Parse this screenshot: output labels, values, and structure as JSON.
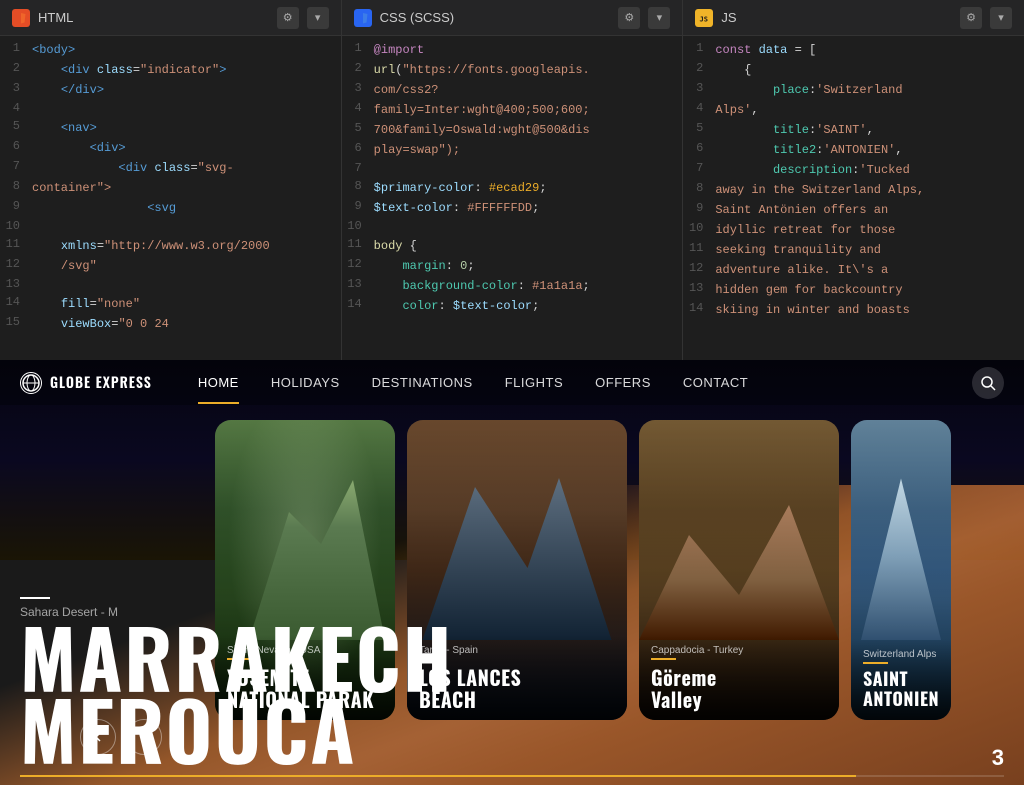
{
  "editor": {
    "panels": [
      {
        "id": "html",
        "tab_icon": "HTML",
        "tab_label": "HTML",
        "tab_color": "html",
        "lines": [
          {
            "num": 1,
            "tokens": [
              {
                "t": "<",
                "c": "c-tag"
              },
              {
                "t": "body",
                "c": "c-tag"
              },
              {
                "t": ">",
                "c": "c-tag"
              }
            ]
          },
          {
            "num": 2,
            "tokens": [
              {
                "t": "    ",
                "c": ""
              },
              {
                "t": "<",
                "c": "c-tag"
              },
              {
                "t": "div",
                "c": "c-tag"
              },
              {
                "t": " ",
                "c": ""
              },
              {
                "t": "class",
                "c": "c-attr"
              },
              {
                "t": "=\"",
                "c": "c-str"
              },
              {
                "t": "indicator",
                "c": "c-str"
              },
              {
                "t": "\">",
                "c": "c-str"
              }
            ]
          },
          {
            "num": 3,
            "tokens": [
              {
                "t": "    ",
                "c": ""
              },
              {
                "t": "</",
                "c": "c-tag"
              },
              {
                "t": "div",
                "c": "c-tag"
              },
              {
                "t": ">",
                "c": "c-tag"
              }
            ]
          },
          {
            "num": 4,
            "tokens": []
          },
          {
            "num": 5,
            "tokens": [
              {
                "t": "    ",
                "c": ""
              },
              {
                "t": "<",
                "c": "c-tag"
              },
              {
                "t": "nav",
                "c": "c-tag"
              },
              {
                "t": ">",
                "c": "c-tag"
              }
            ]
          },
          {
            "num": 6,
            "tokens": [
              {
                "t": "        ",
                "c": ""
              },
              {
                "t": "<",
                "c": "c-tag"
              },
              {
                "t": "div",
                "c": "c-tag"
              },
              {
                "t": ">",
                "c": "c-tag"
              }
            ]
          },
          {
            "num": 7,
            "tokens": [
              {
                "t": "            ",
                "c": ""
              },
              {
                "t": "<",
                "c": "c-tag"
              },
              {
                "t": "div",
                "c": "c-tag"
              },
              {
                "t": " ",
                "c": ""
              },
              {
                "t": "class",
                "c": "c-attr"
              },
              {
                "t": "=\"",
                "c": "c-str"
              },
              {
                "t": "svg-",
                "c": "c-str"
              }
            ]
          },
          {
            "num": 8,
            "tokens": [
              {
                "t": "container\">",
                "c": "c-str"
              }
            ]
          },
          {
            "num": 9,
            "tokens": [
              {
                "t": "                ",
                "c": ""
              },
              {
                "t": "<",
                "c": "c-tag"
              },
              {
                "t": "svg",
                "c": "c-tag"
              }
            ]
          },
          {
            "num": 10,
            "tokens": []
          },
          {
            "num": 11,
            "tokens": [
              {
                "t": "    ",
                "c": ""
              },
              {
                "t": "xmlns",
                "c": "c-attr"
              },
              {
                "t": "=\"",
                "c": "c-str"
              },
              {
                "t": "http://www.w3.org/2000",
                "c": "c-str"
              }
            ]
          },
          {
            "num": 12,
            "tokens": [
              {
                "t": "    ",
                "c": ""
              },
              {
                "t": "/svg\"",
                "c": "c-str"
              }
            ]
          },
          {
            "num": 13,
            "tokens": []
          },
          {
            "num": 14,
            "tokens": [
              {
                "t": "    ",
                "c": ""
              },
              {
                "t": "fill",
                "c": "c-attr"
              },
              {
                "t": "=\"",
                "c": "c-str"
              },
              {
                "t": "none\"",
                "c": "c-str"
              }
            ]
          },
          {
            "num": 15,
            "tokens": [
              {
                "t": "    ",
                "c": ""
              },
              {
                "t": "viewBox",
                "c": "c-attr"
              },
              {
                "t": "=\"0 0 24",
                "c": "c-str"
              }
            ]
          }
        ]
      },
      {
        "id": "css",
        "tab_icon": "CSS",
        "tab_label": "CSS (SCSS)",
        "tab_color": "css",
        "lines": [
          {
            "num": 1,
            "tokens": [
              {
                "t": "@import",
                "c": "c-kw"
              }
            ]
          },
          {
            "num": 2,
            "tokens": [
              {
                "t": "url(\"https://fonts.googleapis.",
                "c": "c-str"
              }
            ]
          },
          {
            "num": 3,
            "tokens": [
              {
                "t": "com/css2?",
                "c": "c-str"
              }
            ]
          },
          {
            "num": 4,
            "tokens": [
              {
                "t": "family=Inter:wght@400;500;600;",
                "c": "c-str"
              }
            ]
          },
          {
            "num": 5,
            "tokens": [
              {
                "t": "700&family=Oswald:wght@500&dis",
                "c": "c-str"
              }
            ]
          },
          {
            "num": 6,
            "tokens": [
              {
                "t": "play=swap\");",
                "c": "c-str"
              }
            ]
          },
          {
            "num": 7,
            "tokens": []
          },
          {
            "num": 8,
            "tokens": [
              {
                "t": "$primary-color",
                "c": "c-var"
              },
              {
                "t": ": ",
                "c": ""
              },
              {
                "t": "#ecad29",
                "c": "c-yellow"
              },
              {
                "t": ";",
                "c": ""
              }
            ]
          },
          {
            "num": 9,
            "tokens": [
              {
                "t": "$text-color",
                "c": "c-var"
              },
              {
                "t": ": ",
                "c": ""
              },
              {
                "t": "#FFFFFFDD",
                "c": "c-str"
              },
              {
                "t": ";",
                "c": ""
              }
            ]
          },
          {
            "num": 10,
            "tokens": []
          },
          {
            "num": 11,
            "tokens": [
              {
                "t": "body",
                "c": "c-fn"
              },
              {
                "t": " {",
                "c": ""
              }
            ]
          },
          {
            "num": 12,
            "tokens": [
              {
                "t": "    ",
                "c": ""
              },
              {
                "t": "margin",
                "c": "c-prop"
              },
              {
                "t": ": ",
                "c": ""
              },
              {
                "t": "0",
                "c": "c-num"
              },
              {
                "t": ";",
                "c": ""
              }
            ]
          },
          {
            "num": 13,
            "tokens": [
              {
                "t": "    ",
                "c": ""
              },
              {
                "t": "background-color",
                "c": "c-prop"
              },
              {
                "t": ": ",
                "c": ""
              },
              {
                "t": "#1a1a1a",
                "c": "c-str"
              },
              {
                "t": ";",
                "c": ""
              }
            ]
          },
          {
            "num": 14,
            "tokens": [
              {
                "t": "    ",
                "c": ""
              },
              {
                "t": "color",
                "c": "c-prop"
              },
              {
                "t": ": ",
                "c": ""
              },
              {
                "t": "$text-color",
                "c": "c-var"
              },
              {
                "t": ";",
                "c": ""
              }
            ]
          }
        ]
      },
      {
        "id": "js",
        "tab_icon": "JS",
        "tab_label": "JS",
        "tab_color": "js",
        "lines": [
          {
            "num": 1,
            "tokens": [
              {
                "t": "const",
                "c": "c-kw"
              },
              {
                "t": " data = [",
                "c": ""
              }
            ]
          },
          {
            "num": 2,
            "tokens": [
              {
                "t": "    {",
                "c": ""
              }
            ]
          },
          {
            "num": 3,
            "tokens": [
              {
                "t": "        ",
                "c": ""
              },
              {
                "t": "place:",
                "c": "c-prop"
              },
              {
                "t": "'Switzerland",
                "c": "c-str"
              }
            ]
          },
          {
            "num": 4,
            "tokens": [
              {
                "t": "Alps',",
                "c": "c-str"
              }
            ]
          },
          {
            "num": 5,
            "tokens": [
              {
                "t": "        ",
                "c": ""
              },
              {
                "t": "title:",
                "c": "c-prop"
              },
              {
                "t": "'SAINT'",
                "c": "c-str"
              },
              {
                "t": ",",
                "c": ""
              }
            ]
          },
          {
            "num": 6,
            "tokens": [
              {
                "t": "        ",
                "c": ""
              },
              {
                "t": "title2:",
                "c": "c-prop"
              },
              {
                "t": "'ANTONIEN'",
                "c": "c-str"
              },
              {
                "t": ",",
                "c": ""
              }
            ]
          },
          {
            "num": 7,
            "tokens": [
              {
                "t": "        ",
                "c": ""
              },
              {
                "t": "description:",
                "c": "c-prop"
              },
              {
                "t": "'Tucked",
                "c": "c-str"
              }
            ]
          },
          {
            "num": 8,
            "tokens": [
              {
                "t": "away in the Switzerland Alps,",
                "c": "c-str"
              }
            ]
          },
          {
            "num": 9,
            "tokens": [
              {
                "t": "Saint Antönien offers an",
                "c": "c-str"
              }
            ]
          },
          {
            "num": 10,
            "tokens": [
              {
                "t": "idyllic retreat for those",
                "c": "c-str"
              }
            ]
          },
          {
            "num": 11,
            "tokens": [
              {
                "t": "seeking tranquility and",
                "c": "c-str"
              }
            ]
          },
          {
            "num": 12,
            "tokens": [
              {
                "t": "adventure alike. It\\'s a",
                "c": "c-str"
              }
            ]
          },
          {
            "num": 13,
            "tokens": [
              {
                "t": "hidden gem for backcountry",
                "c": "c-str"
              }
            ]
          },
          {
            "num": 14,
            "tokens": [
              {
                "t": "skiing in winter and boasts",
                "c": "c-str"
              }
            ]
          }
        ]
      }
    ]
  },
  "preview": {
    "logo": "GLOBE EXPRESS",
    "logo_icon": "⊕",
    "nav_links": [
      "HOME",
      "HOLIDAYS",
      "DESTINATIONS",
      "FLIGHTS",
      "OFFERS",
      "CONTACT"
    ],
    "active_nav": "HOME",
    "cards": [
      {
        "location": "Sierra Nevada - USA",
        "dash": true,
        "title1": "YOSEMITE",
        "title2": "NATIONAL PARAK"
      },
      {
        "location": "Tarifa - Spain",
        "dash": true,
        "title1": "LOS LANCES",
        "title2": "BEACH"
      },
      {
        "location": "Cappadocia - Turkey",
        "dash": true,
        "title1": "Göreme",
        "title2": "Valley"
      },
      {
        "location": "Switzerland Alps",
        "dash": true,
        "title1": "SAINT",
        "title2": "ANTONIEN"
      }
    ],
    "main_subtitle": "Sahara Desert - M",
    "main_title_1": "MARRAKECH",
    "main_title_2": "MEROUCA",
    "slide_number": "3",
    "nav_prev": "◀",
    "nav_next": "▶"
  }
}
